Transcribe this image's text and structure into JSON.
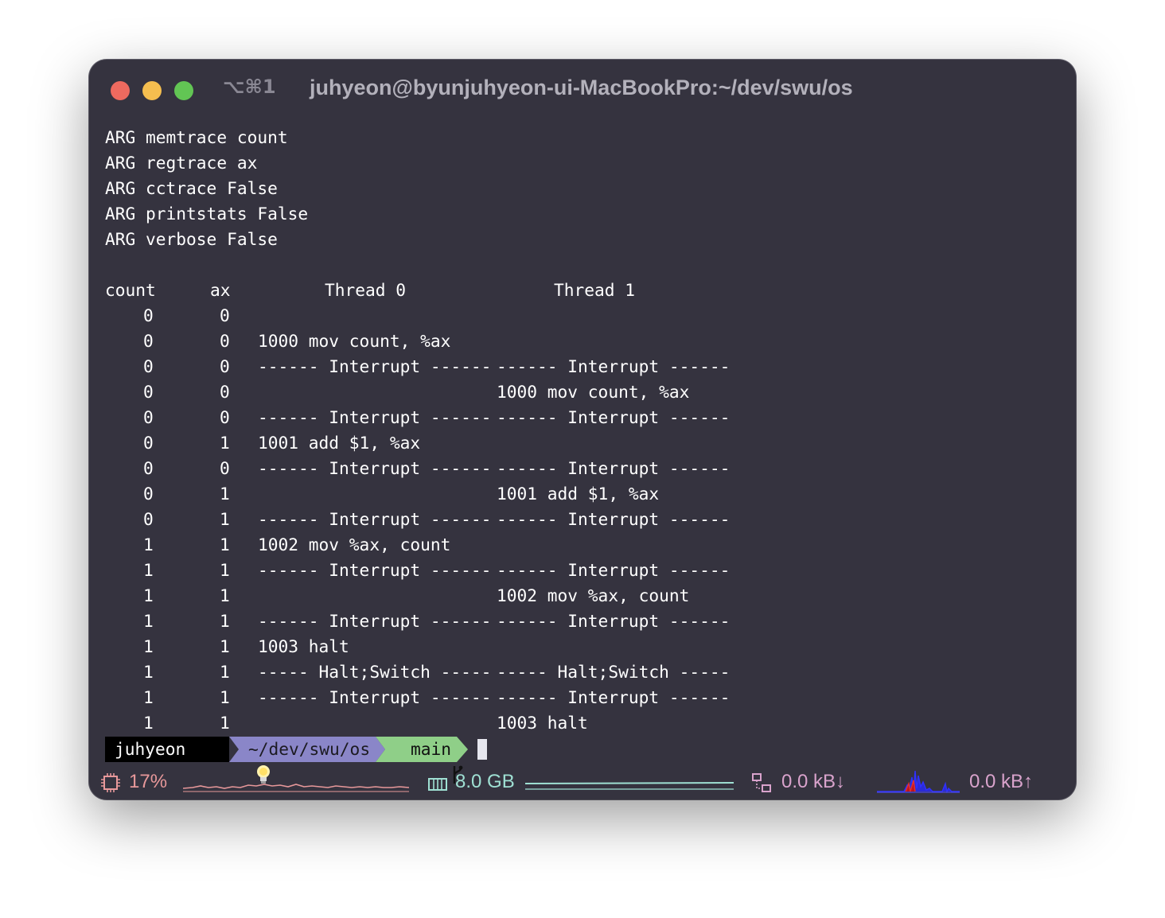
{
  "window": {
    "shortcut": "⌥⌘1",
    "title": "juhyeon@byunjuhyeon-ui-MacBookPro:~/dev/swu/os",
    "colors": {
      "background": "#35333f",
      "close": "#ee6a5f",
      "minimize": "#f5be4f",
      "zoom": "#62c554"
    }
  },
  "args": [
    "ARG memtrace count",
    "ARG regtrace ax",
    "ARG cctrace False",
    "ARG printstats False",
    "ARG verbose False"
  ],
  "table": {
    "headers": [
      "count",
      "ax",
      "Thread 0",
      "Thread 1"
    ],
    "rows": [
      {
        "count": "0",
        "ax": "0",
        "t0": "",
        "t1": ""
      },
      {
        "count": "0",
        "ax": "0",
        "t0": "1000 mov count, %ax",
        "t1": ""
      },
      {
        "count": "0",
        "ax": "0",
        "t0": "------ Interrupt ------",
        "t1": "------ Interrupt ------"
      },
      {
        "count": "0",
        "ax": "0",
        "t0": "",
        "t1": "1000 mov count, %ax"
      },
      {
        "count": "0",
        "ax": "0",
        "t0": "------ Interrupt ------",
        "t1": "------ Interrupt ------"
      },
      {
        "count": "0",
        "ax": "1",
        "t0": "1001 add $1, %ax",
        "t1": ""
      },
      {
        "count": "0",
        "ax": "0",
        "t0": "------ Interrupt ------",
        "t1": "------ Interrupt ------"
      },
      {
        "count": "0",
        "ax": "1",
        "t0": "",
        "t1": "1001 add $1, %ax"
      },
      {
        "count": "0",
        "ax": "1",
        "t0": "------ Interrupt ------",
        "t1": "------ Interrupt ------"
      },
      {
        "count": "1",
        "ax": "1",
        "t0": "1002 mov %ax, count",
        "t1": ""
      },
      {
        "count": "1",
        "ax": "1",
        "t0": "------ Interrupt ------",
        "t1": "------ Interrupt ------"
      },
      {
        "count": "1",
        "ax": "1",
        "t0": "",
        "t1": "1002 mov %ax, count"
      },
      {
        "count": "1",
        "ax": "1",
        "t0": "------ Interrupt ------",
        "t1": "------ Interrupt ------"
      },
      {
        "count": "1",
        "ax": "1",
        "t0": "1003 halt",
        "t1": ""
      },
      {
        "count": "1",
        "ax": "1",
        "t0": "----- Halt;Switch -----",
        "t1": "----- Halt;Switch -----"
      },
      {
        "count": "1",
        "ax": "1",
        "t0": "------ Interrupt ------",
        "t1": "------ Interrupt ------"
      },
      {
        "count": "1",
        "ax": "1",
        "t0": "",
        "t1": "1003 halt"
      }
    ]
  },
  "prompt": {
    "user": "juhyeon",
    "user_icon": "lightbulb-icon",
    "path": "~/dev/swu/os",
    "branch_icon": "git-branch-icon",
    "branch": "main",
    "colors": {
      "user_bg": "#000000",
      "path_bg": "#8a86c8",
      "branch_bg": "#8fcf88"
    }
  },
  "statusbar": {
    "cpu_icon": "cpu-icon",
    "cpu": "17%",
    "memory_icon": "memory-icon",
    "memory": "8.0 GB",
    "network_icon": "network-icon",
    "down": "0.0 kB↓",
    "up": "0.0 kB↑",
    "colors": {
      "cpu": "#e7989a",
      "memory": "#9fe0d3",
      "network": "#d9a3cc"
    }
  }
}
